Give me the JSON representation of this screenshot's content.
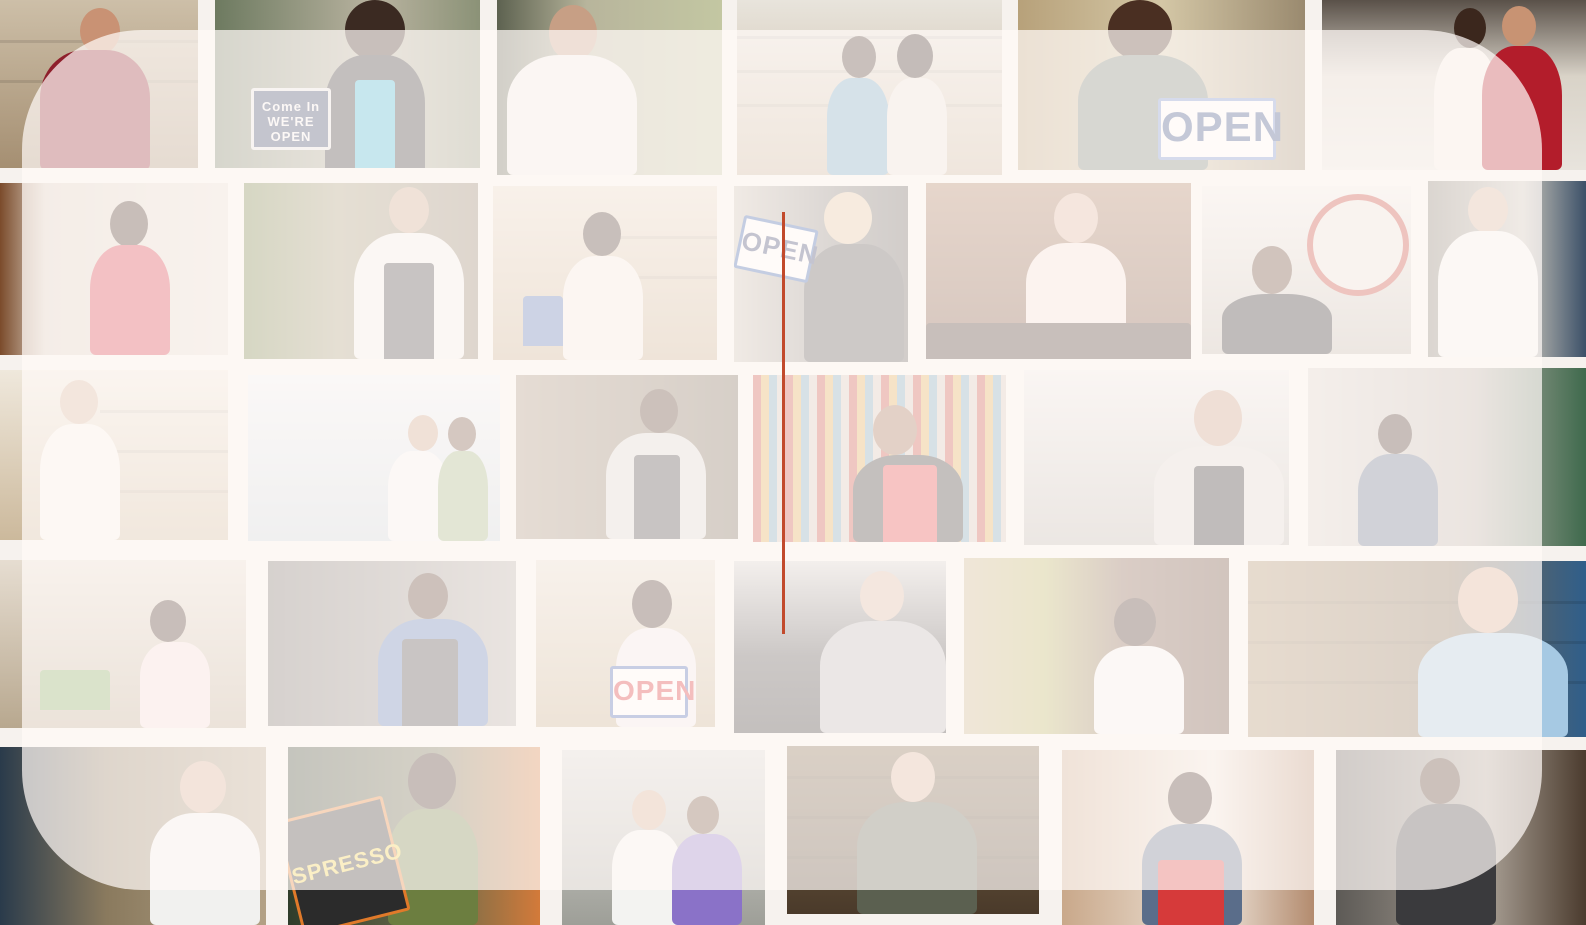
{
  "collage": {
    "rows": [
      [
        {
          "subject": "man-in-red-sweater"
        },
        {
          "subject": "woman-with-open-sign",
          "sign": "Come In WE'RE OPEN"
        },
        {
          "subject": "older-man-in-white-shirt"
        },
        {
          "subject": "two-women-in-shop"
        },
        {
          "subject": "man-with-open-sign",
          "sign": "OPEN"
        },
        {
          "subject": "couple-in-red-and-white"
        }
      ],
      [
        {
          "subject": "woman-in-red-apron"
        },
        {
          "subject": "florist-in-striped-apron"
        },
        {
          "subject": "woman-in-gift-shop"
        },
        {
          "subject": "woman-holding-open-sign",
          "sign": "OPEN"
        },
        {
          "subject": "older-man-at-counter"
        },
        {
          "subject": "man-in-cafe"
        },
        {
          "subject": "man-in-white-apron"
        }
      ],
      [
        {
          "subject": "baker-woman"
        },
        {
          "subject": "couple-in-doorway"
        },
        {
          "subject": "man-in-apron-in-doorway"
        },
        {
          "subject": "man-in-red-apron-in-market"
        },
        {
          "subject": "bearded-man-in-apron"
        },
        {
          "subject": "woman-in-clothing-store"
        }
      ],
      [
        {
          "subject": "woman-in-bike-shop"
        },
        {
          "subject": "man-in-blue-shirt-and-apron"
        },
        {
          "subject": "woman-with-open-sign",
          "sign": "OPEN"
        },
        {
          "subject": "man-in-bike-shop"
        },
        {
          "subject": "woman-in-fabric-store"
        },
        {
          "subject": "man-in-grocery-store"
        }
      ],
      [
        {
          "subject": "man-in-bookstore"
        },
        {
          "subject": "woman-with-chalkboard",
          "sign": "SPRESSO"
        },
        {
          "subject": "couple-in-bike-shop"
        },
        {
          "subject": "man-in-liquor-store"
        },
        {
          "subject": "woman-in-red-apron-in-cafe"
        },
        {
          "subject": "man-in-vest"
        }
      ]
    ]
  },
  "colors": {
    "overlay": "#fff9f7",
    "cursor": "#c24a2c",
    "sign_blue": "#2f5fa8",
    "sign_red": "#d8262e"
  }
}
